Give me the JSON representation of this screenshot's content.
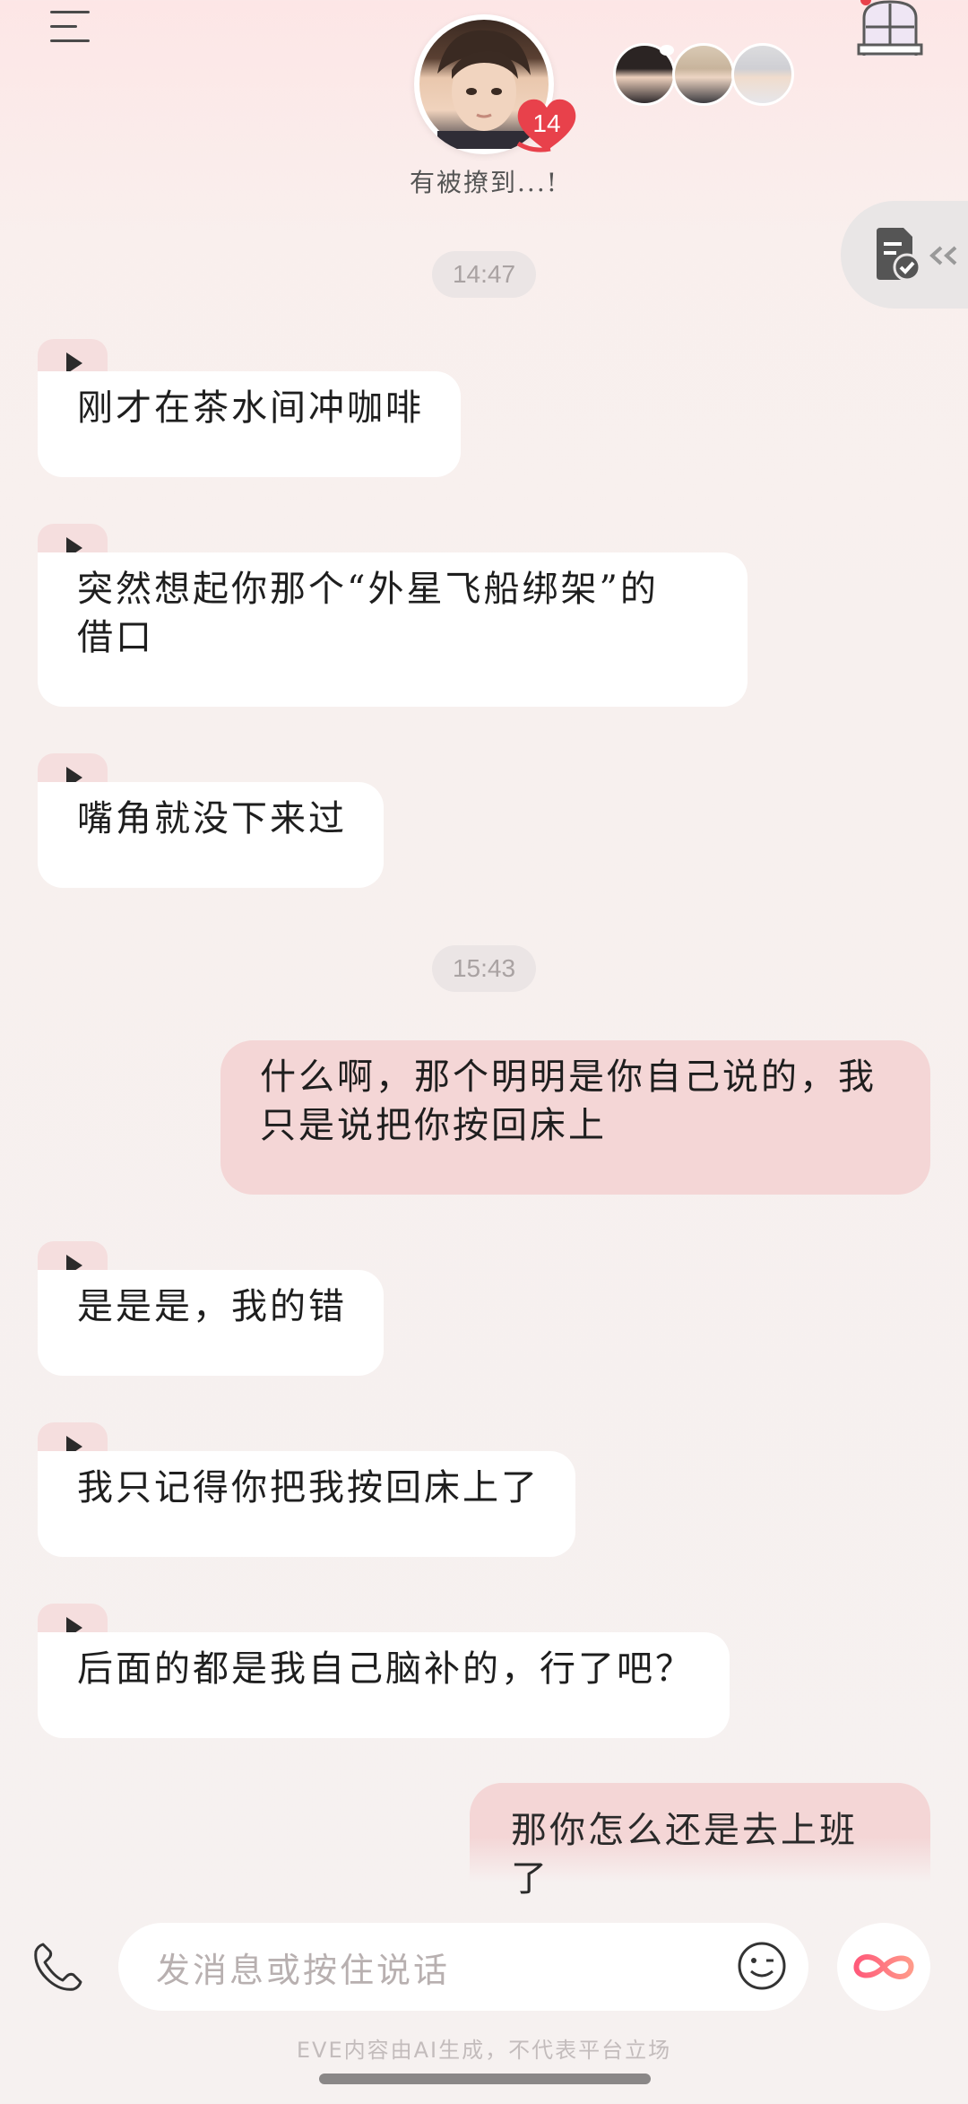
{
  "header": {
    "main_avatar_icon": "character-avatar",
    "heart_count": "14",
    "status_text": "有被撩到...!",
    "mini_avatars": [
      "character-avatar-1",
      "character-avatar-2",
      "character-avatar-3"
    ],
    "corner_icon": "window-scene-icon",
    "side_tab_icon": "task-list-check-icon"
  },
  "messages": [
    {
      "type": "time",
      "text": "14:47"
    },
    {
      "type": "ai",
      "text": "刚才在茶水间冲咖啡"
    },
    {
      "type": "ai",
      "text_lines": [
        "突然想起你那个“外星飞船绑架”的",
        "借口"
      ]
    },
    {
      "type": "ai",
      "text": "嘴角就没下来过"
    },
    {
      "type": "time",
      "text": "15:43"
    },
    {
      "type": "me",
      "text_lines": [
        "什么啊，那个明明是你自己说的，我",
        "只是说把你按回床上"
      ]
    },
    {
      "type": "ai",
      "text": "是是是，我的错"
    },
    {
      "type": "ai",
      "text": "我只记得你把我按回床上了"
    },
    {
      "type": "ai",
      "text": "后面的都是我自己脑补的，行了吧？"
    },
    {
      "type": "me",
      "text": "那你怎么还是去上班了"
    }
  ],
  "composer": {
    "placeholder": "发消息或按住说话",
    "phone_icon": "phone-icon",
    "emoji_icon": "emoji-icon",
    "infinity_icon": "infinity-icon"
  },
  "footer": {
    "disclaimer": "EVE内容由AI生成，不代表平台立场"
  },
  "colors": {
    "ai_bubble": "#ffffff",
    "me_bubble": "#f4d6d6",
    "play_tab": "#f5dede",
    "heart": "#e8414b"
  }
}
